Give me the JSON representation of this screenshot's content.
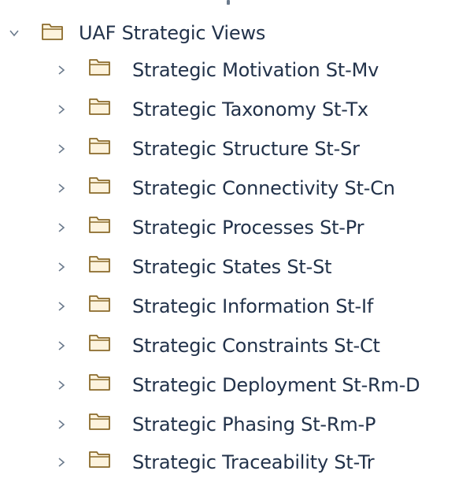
{
  "tree": {
    "root": {
      "label": "UAF Strategic Views",
      "expanded": true,
      "icon": "folder-icon",
      "chevron": "chevron-down-icon"
    },
    "children": [
      {
        "label": "Strategic Motivation St-Mv",
        "icon": "folder-icon",
        "chevron": "chevron-right-icon"
      },
      {
        "label": "Strategic Taxonomy St-Tx",
        "icon": "folder-icon",
        "chevron": "chevron-right-icon"
      },
      {
        "label": "Strategic Structure St-Sr",
        "icon": "folder-icon",
        "chevron": "chevron-right-icon"
      },
      {
        "label": "Strategic Connectivity St-Cn",
        "icon": "folder-icon",
        "chevron": "chevron-right-icon"
      },
      {
        "label": "Strategic Processes St-Pr",
        "icon": "folder-icon",
        "chevron": "chevron-right-icon"
      },
      {
        "label": "Strategic States St-St",
        "icon": "folder-icon",
        "chevron": "chevron-right-icon"
      },
      {
        "label": "Strategic Information St-If",
        "icon": "folder-icon",
        "chevron": "chevron-right-icon"
      },
      {
        "label": "Strategic Constraints St-Ct",
        "icon": "folder-icon",
        "chevron": "chevron-right-icon"
      },
      {
        "label": "Strategic Deployment St-Rm-D",
        "icon": "folder-icon",
        "chevron": "chevron-right-icon"
      },
      {
        "label": "Strategic Phasing St-Rm-P",
        "icon": "folder-icon",
        "chevron": "chevron-right-icon"
      },
      {
        "label": "Strategic Traceability St-Tr",
        "icon": "folder-icon",
        "chevron": "chevron-right-icon"
      }
    ]
  },
  "colors": {
    "text": "#22324a",
    "chevron": "#6b7a8c",
    "folder_fill": "#fdf3dd",
    "folder_stroke": "#8a6a2a"
  }
}
